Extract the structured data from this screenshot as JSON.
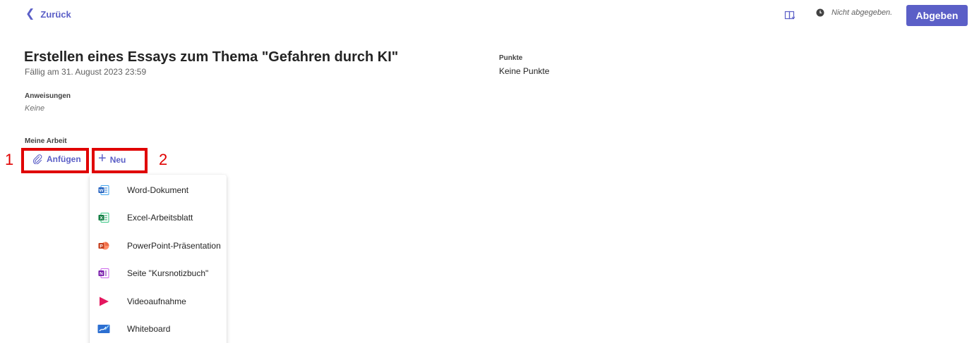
{
  "header": {
    "back_label": "Zurück",
    "status_text": "Nicht abgegeben.",
    "submit_label": "Abgeben",
    "accent_color": "#5b5fc7"
  },
  "assignment": {
    "title": "Erstellen eines Essays zum Thema \"Gefahren durch KI\"",
    "due": "Fällig am 31. August 2023 23:59",
    "points_label": "Punkte",
    "points_value": "Keine Punkte",
    "instructions_label": "Anweisungen",
    "instructions_value": "Keine",
    "my_work_label": "Meine Arbeit"
  },
  "actions": {
    "attach_label": "Anfügen",
    "new_label": "Neu"
  },
  "annotations": {
    "marker_1": "1",
    "marker_2": "2",
    "highlight_color": "#e00000"
  },
  "new_menu": {
    "items": [
      {
        "label": "Word-Dokument",
        "icon": "word-icon"
      },
      {
        "label": "Excel-Arbeitsblatt",
        "icon": "excel-icon"
      },
      {
        "label": "PowerPoint-Präsentation",
        "icon": "powerpoint-icon"
      },
      {
        "label": "Seite \"Kursnotizbuch\"",
        "icon": "onenote-icon"
      },
      {
        "label": "Videoaufnahme",
        "icon": "video-icon"
      },
      {
        "label": "Whiteboard",
        "icon": "whiteboard-icon"
      }
    ]
  }
}
